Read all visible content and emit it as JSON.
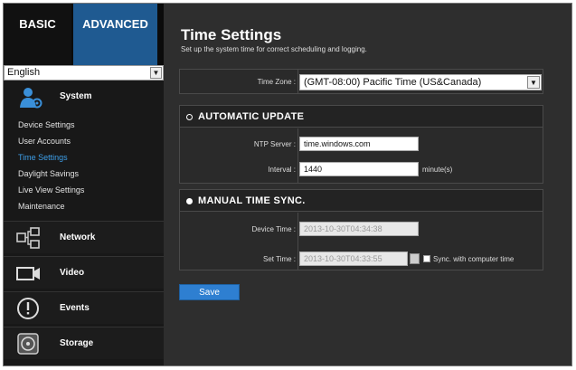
{
  "top_tabs": {
    "basic": "BASIC",
    "advanced": "ADVANCED"
  },
  "language": {
    "selected": "English"
  },
  "sidebar": {
    "system": {
      "label": "System",
      "items": [
        {
          "label": "Device Settings"
        },
        {
          "label": "User Accounts"
        },
        {
          "label": "Time Settings"
        },
        {
          "label": "Daylight Savings"
        },
        {
          "label": "Live View Settings"
        },
        {
          "label": "Maintenance"
        }
      ]
    },
    "sections": [
      {
        "label": "Network",
        "icon": "network-icon"
      },
      {
        "label": "Video",
        "icon": "video-camera-icon"
      },
      {
        "label": "Events",
        "icon": "alert-icon"
      },
      {
        "label": "Storage",
        "icon": "hard-disk-icon"
      }
    ]
  },
  "page": {
    "title": "Time Settings",
    "subtitle": "Set up the system time for correct scheduling and logging."
  },
  "time_zone": {
    "label": "Time Zone :",
    "value": "(GMT-08:00) Pacific Time (US&Canada)"
  },
  "automatic_update": {
    "title": "AUTOMATIC UPDATE",
    "ntp_label": "NTP Server :",
    "ntp_value": "time.windows.com",
    "interval_label": "Interval :",
    "interval_value": "1440",
    "interval_unit": "minute(s)"
  },
  "manual_sync": {
    "title": "MANUAL TIME SYNC.",
    "device_time_label": "Device Time :",
    "device_time_value": "2013-10-30T04:34:38",
    "set_time_label": "Set Time :",
    "set_time_value": "2013-10-30T04:33:55",
    "sync_label": "Sync. with computer time",
    "sync_checked": false
  },
  "actions": {
    "save": "Save"
  },
  "colors": {
    "accent": "#1f5a91",
    "active_link": "#3d9ee8",
    "button": "#2e7fd1"
  }
}
